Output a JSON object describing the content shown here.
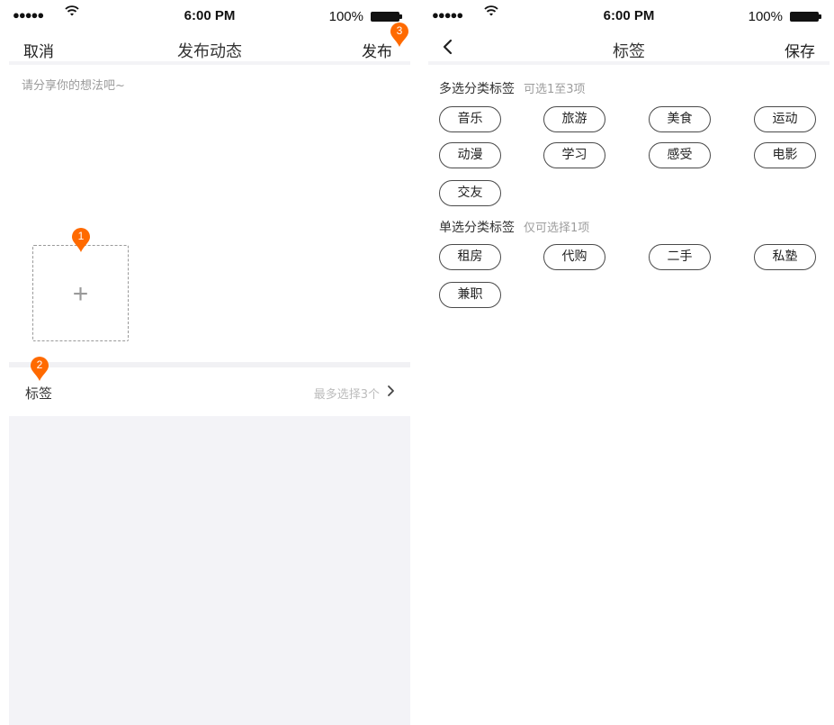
{
  "status_bar": {
    "time": "6:00 PM",
    "battery": "100%",
    "signal": "●●●●●"
  },
  "publish_screen": {
    "cancel_label": "取消",
    "title": "发布动态",
    "publish_label": "发布",
    "text_placeholder": "请分享你的想法吧~",
    "add_photo_symbol": "+",
    "tag_row": {
      "label": "标签",
      "hint": "最多选择3个"
    },
    "markers": [
      "1",
      "2",
      "3"
    ]
  },
  "tag_screen": {
    "title": "标签",
    "save_label": "保存",
    "multi_section": {
      "title": "多选分类标签",
      "subtitle": "可选1至3项",
      "tags": [
        "音乐",
        "旅游",
        "美食",
        "运动",
        "动漫",
        "学习",
        "感受",
        "电影",
        "交友"
      ]
    },
    "single_section": {
      "title": "单选分类标签",
      "subtitle": "仅可选择1项",
      "tags": [
        "租房",
        "代购",
        "二手",
        "私塾",
        "兼职"
      ]
    }
  },
  "colors": {
    "marker": "#ff6a00",
    "background_gray": "#f3f3f7"
  }
}
